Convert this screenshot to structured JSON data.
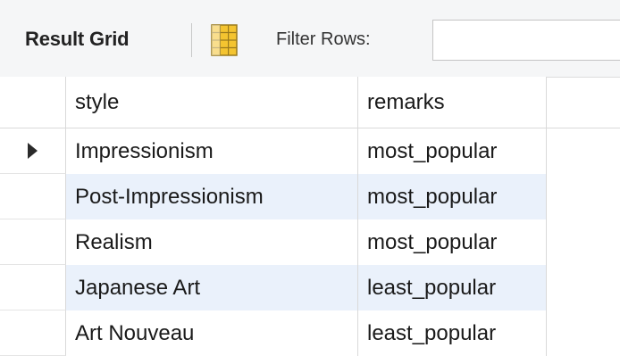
{
  "toolbar": {
    "title": "Result Grid",
    "filter_label": "Filter Rows:",
    "filter_value": "",
    "grid_icon": "grid-layout-icon"
  },
  "columns": [
    "style",
    "remarks"
  ],
  "rows": [
    {
      "style": "Impressionism",
      "remarks": "most_popular",
      "current": true
    },
    {
      "style": "Post-Impressionism",
      "remarks": "most_popular",
      "current": false
    },
    {
      "style": "Realism",
      "remarks": "most_popular",
      "current": false
    },
    {
      "style": "Japanese Art",
      "remarks": "least_popular",
      "current": false
    },
    {
      "style": "Art Nouveau",
      "remarks": "least_popular",
      "current": false
    }
  ],
  "colors": {
    "alt_row": "#eaf1fb",
    "toolbar_bg": "#f5f6f7",
    "icon_yellow": "#f4c430"
  }
}
